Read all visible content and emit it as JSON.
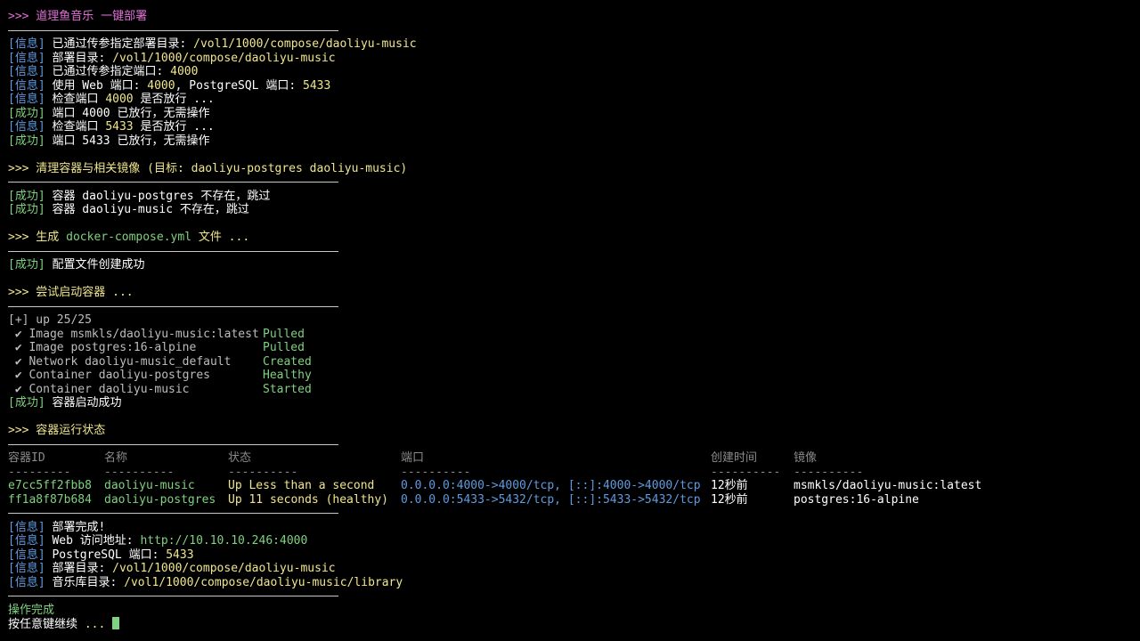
{
  "colors": {
    "magenta": "#e26fd8",
    "yellow": "#f0e68c",
    "blue": "#5f9be0",
    "green": "#7fd27f"
  },
  "title": {
    "prompt": ">>>",
    "text": " 道理鱼音乐 一键部署"
  },
  "tags": {
    "info": "[信息]",
    "ok": "[成功]"
  },
  "block1": [
    {
      "tag": "info",
      "label": " 已通过传参指定部署目录: ",
      "value": "/vol1/1000/compose/daoliyu-music"
    },
    {
      "tag": "info",
      "label": " 部署目录: ",
      "value": "/vol1/1000/compose/daoliyu-music"
    },
    {
      "tag": "info",
      "label": " 已通过传参指定端口: ",
      "value": "4000"
    },
    {
      "tag": "info",
      "label": " 使用 Web 端口: ",
      "value": "4000",
      "label2": ", PostgreSQL 端口: ",
      "value2": "5433"
    },
    {
      "tag": "info",
      "label": " 检查端口 ",
      "value": "4000",
      "label2": " 是否放行 ..."
    },
    {
      "tag": "ok",
      "label": " 端口 4000 已放行，无需操作"
    },
    {
      "tag": "info",
      "label": " 检查端口 ",
      "value": "5433",
      "label2": " 是否放行 ..."
    },
    {
      "tag": "ok",
      "label": " 端口 5433 已放行，无需操作"
    }
  ],
  "section_cleanup": ">>> 清理容器与相关镜像 (目标: daoliyu-postgres daoliyu-music)",
  "block2": [
    {
      "tag": "ok",
      "label": " 容器 daoliyu-postgres 不存在，跳过"
    },
    {
      "tag": "ok",
      "label": " 容器 daoliyu-music 不存在，跳过"
    }
  ],
  "section_gen": {
    "prefix": ">>> 生成 ",
    "file": "docker-compose.yml",
    "suffix": " 文件 ..."
  },
  "block3": {
    "tag": "ok",
    "label": " 配置文件创建成功"
  },
  "section_start": {
    "prefix": ">>> 尝试启动容器 ",
    "suffix": "..."
  },
  "compose": {
    "header": "[+] up 25/25",
    "rows": [
      {
        "check": " ✔ ",
        "name": "Image msmkls/daoliyu-music:latest",
        "status": "Pulled"
      },
      {
        "check": " ✔ ",
        "name": "Image postgres:16-alpine",
        "status": "Pulled"
      },
      {
        "check": " ✔ ",
        "name": "Network daoliyu-music_default",
        "status": "Created"
      },
      {
        "check": " ✔ ",
        "name": "Container daoliyu-postgres",
        "status": "Healthy"
      },
      {
        "check": " ✔ ",
        "name": "Container daoliyu-music",
        "status": "Started"
      }
    ],
    "done": {
      "tag": "ok",
      "label": " 容器启动成功"
    }
  },
  "section_status": ">>> 容器运行状态",
  "table": {
    "headers": [
      "容器ID",
      "名称",
      "状态",
      "端口",
      "创建时间",
      "镜像"
    ],
    "dashes": [
      "---------",
      "----------",
      "----------",
      "----------",
      "----------",
      "----------"
    ],
    "rows": [
      {
        "id": "e7cc5ff2fbb8",
        "name": "daoliyu-music",
        "status": "Up Less than a second",
        "ports": "0.0.0.0:4000->4000/tcp, [::]:4000->4000/tcp",
        "created": "12秒前",
        "image": "msmkls/daoliyu-music:latest"
      },
      {
        "id": "ff1a8f87b684",
        "name": "daoliyu-postgres",
        "status": "Up 11 seconds (healthy)",
        "ports": "0.0.0.0:5433->5432/tcp, [::]:5433->5432/tcp",
        "created": "12秒前",
        "image": "postgres:16-alpine"
      }
    ]
  },
  "summary": [
    {
      "tag": "info",
      "label": " 部署完成!",
      "value": ""
    },
    {
      "tag": "info",
      "label": " Web 访问地址: ",
      "value": "http://10.10.10.246:4000"
    },
    {
      "tag": "info",
      "label": " PostgreSQL 端口: ",
      "value": "5433"
    },
    {
      "tag": "info",
      "label": " 部署目录: ",
      "value": "/vol1/1000/compose/daoliyu-music"
    },
    {
      "tag": "info",
      "label": " 音乐库目录: ",
      "value": "/vol1/1000/compose/daoliyu-music/library"
    }
  ],
  "finish": {
    "done": "操作完成",
    "press": "按任意键继续 ",
    "dots": "..."
  }
}
